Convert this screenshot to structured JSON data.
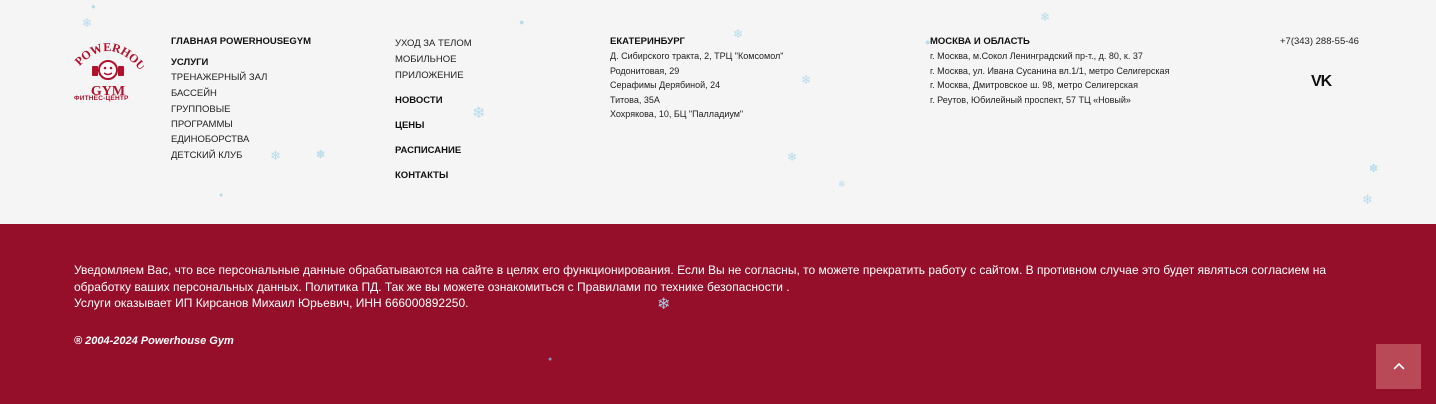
{
  "logo": {
    "line1": "POWERHOUSE",
    "line2": "GYM",
    "subtitle": "ФИТНЕС-ЦЕНТР"
  },
  "col1": {
    "main_link": "ГЛАВНАЯ POWERHOUSEGYM",
    "services_heading": "УСЛУГИ",
    "items": [
      "ТРЕНАЖЕРНЫЙ ЗАЛ",
      "БАССЕЙН",
      "ГРУППОВЫЕ",
      "ПРОГРАММЫ",
      "ЕДИНОБОРСТВА",
      "ДЕТСКИЙ КЛУБ"
    ]
  },
  "col2": {
    "items": [
      "УХОД ЗА ТЕЛОМ",
      "МОБИЛЬНОЕ",
      "ПРИЛОЖЕНИЕ"
    ],
    "bold_items": [
      "НОВОСТИ",
      "ЦЕНЫ",
      "РАСПИСАНИЕ",
      "КОНТАКТЫ"
    ]
  },
  "col3": {
    "heading": "ЕКАТЕРИНБУРГ",
    "addresses": [
      "Д. Сибирского тракта, 2, ТРЦ \"Комсомол\"",
      "Родонитовая, 29",
      "Серафимы Дерябиной, 24",
      "Титова, 35А",
      "Хохрякова, 10, БЦ \"Палладиум\""
    ]
  },
  "col4": {
    "heading": "МОСКВА И ОБЛАСТЬ",
    "addresses": [
      "г. Москва, м.Сокол Ленинградский пр-т., д. 80, к. 37",
      "г. Москва, ул. Ивана Сусанина вл.1/1, метро Селигерская",
      "г. Москва, Дмитровское ш. 98, метро Селигерская",
      "г. Реутов, Юбилейный проспект, 57 ТЦ «Новый»"
    ]
  },
  "contacts": {
    "phone": "+7(343) 288-55-46",
    "social_icon": "vk-icon",
    "vk_label": "VK"
  },
  "notice": {
    "line1": "Уведомляем Вас, что все персональные данные обрабатываются на сайте в целях его функционирования. Если Вы не согласны, то можете прекратить работу с сайтом. В противном случае это будет являться согласием на обработку ваших персональных данных. Политика ПД. Так же вы можете ознакомиться с Правилами по технике безопасности .",
    "line2": "Услуги оказывает ИП Кирсанов Михаил Юрьевич, ИНН 666000892250."
  },
  "copyright": "® 2004-2024 Powerhouse Gym",
  "colors": {
    "brand_red": "#950e2a",
    "footer_bg": "#f5f5f5",
    "to_top_button": "#b94957",
    "snowflake": "#b8dcea"
  }
}
